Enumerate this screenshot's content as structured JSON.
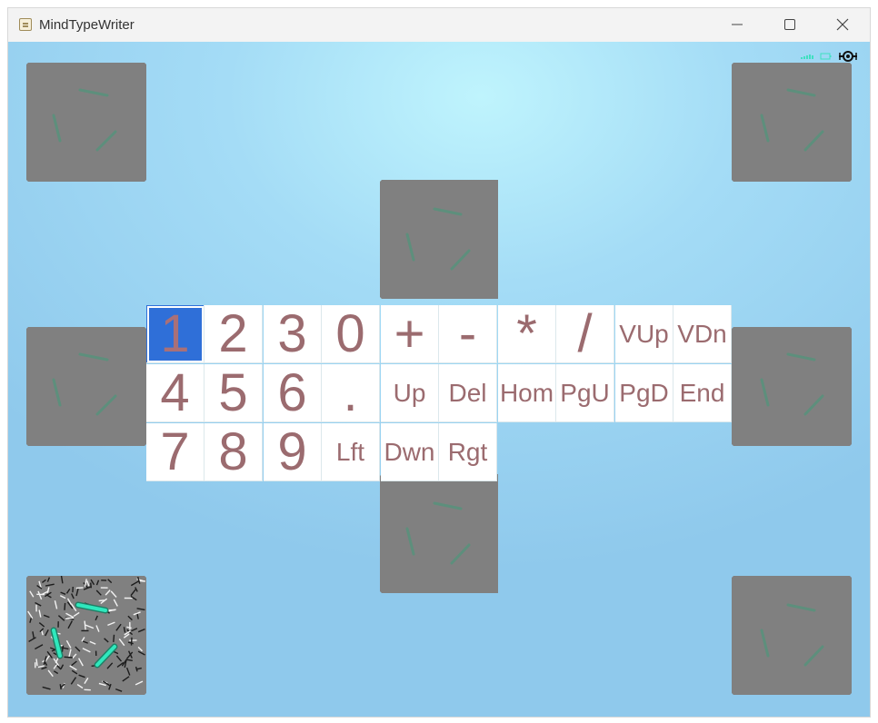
{
  "window": {
    "title": "MindTypeWriter"
  },
  "keypad": {
    "selected_key": "1",
    "rows": [
      [
        "1",
        "2",
        "3",
        "0",
        "+",
        "-",
        "*",
        "/",
        "VUp",
        "VDn"
      ],
      [
        "4",
        "5",
        "6",
        ".",
        "Up",
        "Del",
        "Hom",
        "PgU",
        "PgD",
        "End"
      ],
      [
        "7",
        "8",
        "9",
        "Lft",
        "Dwn",
        "Rgt"
      ]
    ]
  },
  "colors": {
    "key_text": "#9b6b6f",
    "key_selected_bg": "#2f6fd8",
    "target_bg": "#808080",
    "bar_dim": "#5a8f7a",
    "bar_active": "#2fe0b8",
    "background": "#a4dcf6"
  },
  "icons": [
    "app-icon",
    "minimize-icon",
    "maximize-icon",
    "close-icon",
    "signal-icon",
    "battery-icon",
    "headset-icon"
  ],
  "targets": [
    {
      "name": "target-top-left",
      "state": "idle"
    },
    {
      "name": "target-top-right",
      "state": "idle"
    },
    {
      "name": "target-center-top",
      "state": "idle"
    },
    {
      "name": "target-middle-left",
      "state": "idle"
    },
    {
      "name": "target-middle-right",
      "state": "idle"
    },
    {
      "name": "target-center-bottom",
      "state": "idle"
    },
    {
      "name": "target-bottom-left",
      "state": "active"
    },
    {
      "name": "target-bottom-right",
      "state": "idle"
    }
  ]
}
